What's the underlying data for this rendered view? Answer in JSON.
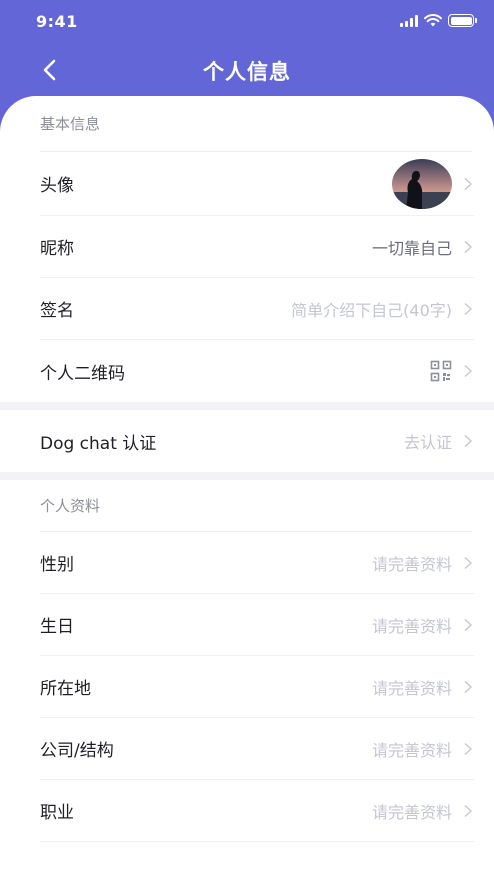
{
  "status_bar": {
    "time": "9:41"
  },
  "nav": {
    "title": "个人信息"
  },
  "basic_section": {
    "title": "基本信息",
    "rows": [
      {
        "label": "头像",
        "value": ""
      },
      {
        "label": "昵称",
        "value": "一切靠自己"
      },
      {
        "label": "签名",
        "value": "简单介绍下自己(40字)"
      },
      {
        "label": "个人二维码",
        "value": ""
      }
    ]
  },
  "verify_row": {
    "label": "Dog chat 认证",
    "value": "去认证"
  },
  "profile_section": {
    "title": "个人资料",
    "rows": [
      {
        "label": "性别",
        "value": "请完善资料"
      },
      {
        "label": "生日",
        "value": "请完善资料"
      },
      {
        "label": "所在地",
        "value": "请完善资料"
      },
      {
        "label": "公司/结构",
        "value": "请完善资料"
      },
      {
        "label": "职业",
        "value": "请完善资料"
      }
    ]
  },
  "colors": {
    "primary": "#6366d6",
    "value_dark": "#6b6d78",
    "placeholder": "#c4c6d0"
  }
}
